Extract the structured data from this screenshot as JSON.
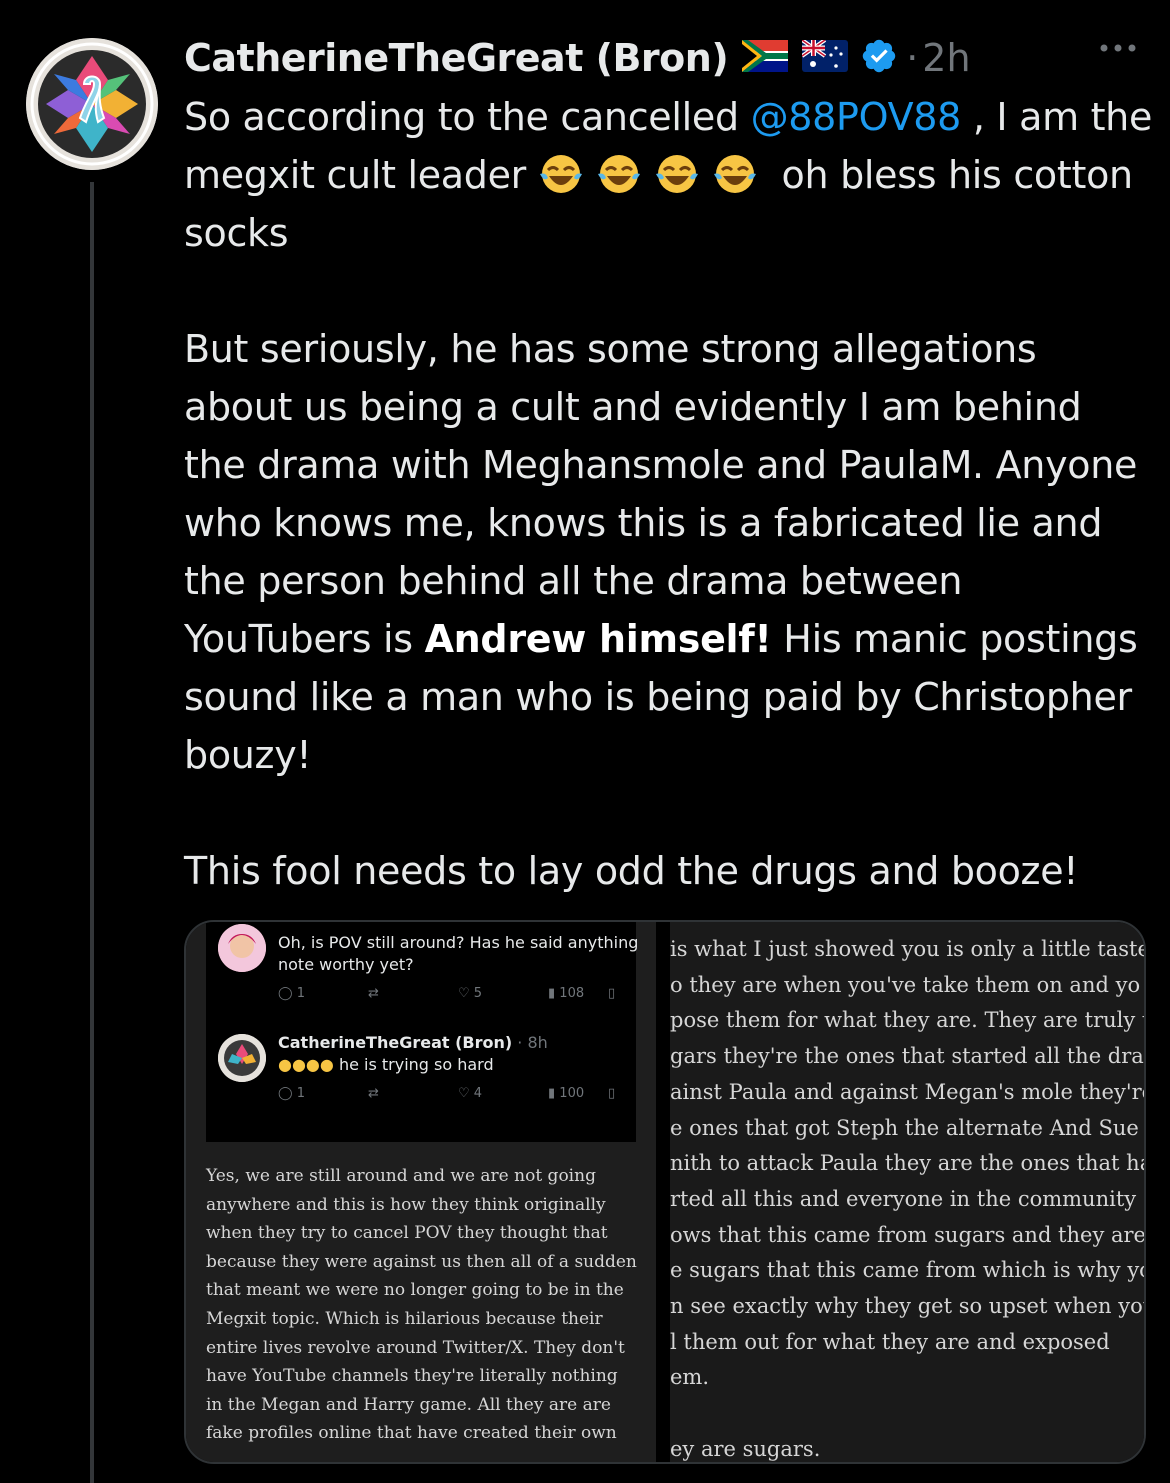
{
  "tweet": {
    "display_name": "CatherineTheGreat (Bron)",
    "dot": "·",
    "time": "2h",
    "body": {
      "p1_before": "So according to the cancelled ",
      "mention": "@88POV88",
      "p1_after": " , I am the megxit cult leader ",
      "p1_end": " oh bless his cotton socks",
      "p2_main": "But seriously, he has some strong allegations about us being a cult and evidently I am behind the drama with Meghansmole and PaulaM. Anyone who knows me, knows this is a fabricated lie and the person behind all the drama between YouTubers is ",
      "p2_bold": "Andrew himself!",
      "p2_end": " His manic postings sound like a man who is being paid by Christopher bouzy!",
      "p3": "This fool needs to lay odd the drugs and booze!"
    },
    "icons": {
      "flag1": "south-africa-flag-icon",
      "flag2": "australia-flag-icon",
      "verified": "verified-badge-icon",
      "more": "more-icon",
      "emoji": "face-with-tears-of-joy-icon"
    }
  },
  "media": {
    "left_panel": {
      "reply1": {
        "text_line1": "Oh, is POV still around?  Has he said anything",
        "text_line2": "note worthy yet?",
        "replies": "1",
        "likes": "5",
        "views": "108"
      },
      "reply2": {
        "name": "CatherineTheGreat (Bron)",
        "time": "· 8h",
        "text": "he is trying so hard",
        "replies": "1",
        "likes": "4",
        "views": "100"
      },
      "screenshot_lines": [
        "Yes, we are still around and we are not going",
        "anywhere and this is how they think originally",
        "when they try to cancel POV they thought that",
        "because they were against us then all of a sudden",
        "that meant we were no longer going to be in the",
        "Megxit topic. Which is hilarious because their",
        "entire lives revolve around Twitter/X. They don't",
        "have YouTube channels they're literally nothing",
        "in the Megan and Harry game. All they are are",
        "fake profiles online that have created their own"
      ]
    },
    "right_panel": {
      "lines": [
        "is what I just showed you is only a little taste",
        "o they are when you've take them on and yo",
        "pose them for what they are. They are truly t",
        "gars they're the ones that started all the dran",
        "ainst Paula and against Megan's mole they're",
        "e ones that got Steph the alternate And Sue",
        "nith to attack Paula they are the ones that hav",
        "rted all this and everyone in the community",
        "ows that this came from sugars and they are",
        "e sugars that this came from which is why yo",
        "n see exactly why they get so upset when you",
        "l them out for what they are and exposed",
        "em.",
        "",
        "ey are sugars."
      ]
    }
  }
}
